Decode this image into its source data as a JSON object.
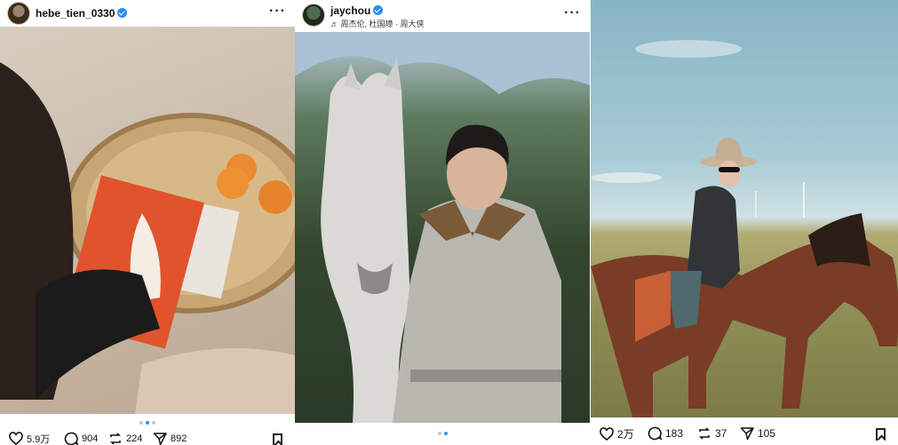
{
  "posts": [
    {
      "username": "hebe_tien_0330",
      "subtitle": "",
      "likes": "5.9万",
      "comments": "904",
      "reposts": "224",
      "shares": "892",
      "carousel_dots": 3,
      "active_dot": 2
    },
    {
      "username": "jaychou",
      "subtitle": "♬ 周杰伦, 杜国璋 · 周大侠",
      "likes": "",
      "comments": "",
      "reposts": "",
      "shares": "",
      "carousel_dots": 2,
      "active_dot": 2
    },
    {
      "username": "",
      "subtitle": "",
      "likes": "2万",
      "comments": "183",
      "reposts": "37",
      "shares": "105"
    }
  ],
  "icons": {
    "like": "heart-icon",
    "comment": "comment-icon",
    "repost": "repost-icon",
    "share": "send-icon",
    "save": "bookmark-icon",
    "verified": "verified-badge-icon",
    "more": "more-icon"
  },
  "colors": {
    "verified": "#2d8cf0",
    "active_dot": "#3a8bf5"
  }
}
